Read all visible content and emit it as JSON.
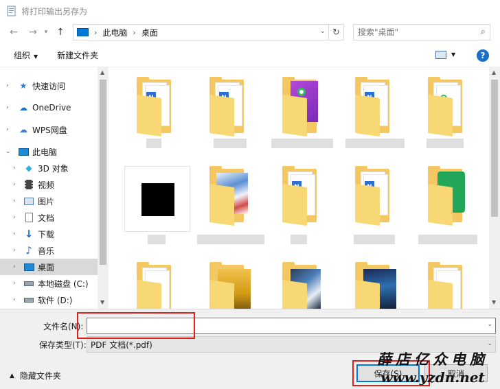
{
  "window": {
    "title": "将打印输出另存为"
  },
  "address": {
    "crumbs": [
      "此电脑",
      "桌面"
    ],
    "separator": "›"
  },
  "search": {
    "placeholder": "搜索\"桌面\""
  },
  "toolbar": {
    "organize": "组织",
    "new_folder": "新建文件夹",
    "help": "?"
  },
  "nav": {
    "items": [
      {
        "label": "快速访问",
        "icon": "star-icon"
      },
      {
        "label": "OneDrive",
        "icon": "cloud-icon"
      },
      {
        "label": "WPS网盘",
        "icon": "cloud-outline-icon"
      },
      {
        "label": "此电脑",
        "icon": "computer-icon"
      },
      {
        "label": "3D 对象",
        "icon": "cube-icon"
      },
      {
        "label": "视频",
        "icon": "film-icon"
      },
      {
        "label": "图片",
        "icon": "picture-icon"
      },
      {
        "label": "文档",
        "icon": "document-icon"
      },
      {
        "label": "下载",
        "icon": "download-arrow-icon"
      },
      {
        "label": "音乐",
        "icon": "music-note-icon"
      },
      {
        "label": "桌面",
        "icon": "desktop-icon"
      },
      {
        "label": "本地磁盘 (C:)",
        "icon": "drive-icon"
      },
      {
        "label": "软件 (D:)",
        "icon": "drive-icon"
      }
    ],
    "selected": "桌面"
  },
  "form": {
    "filename_label": "文件名(N):",
    "filename_value": "",
    "filetype_label": "保存类型(T):",
    "filetype_value": "PDF 文档(*.pdf)",
    "hide_folders": "隐藏文件夹",
    "save": "保存(S)",
    "cancel": "取消"
  },
  "watermark": {
    "line1": "薛店亿众电脑",
    "line2": "www.yzdn.net"
  },
  "colors": {
    "accent": "#0078d7",
    "highlight": "#e0201c",
    "folder": "#f3c862"
  }
}
